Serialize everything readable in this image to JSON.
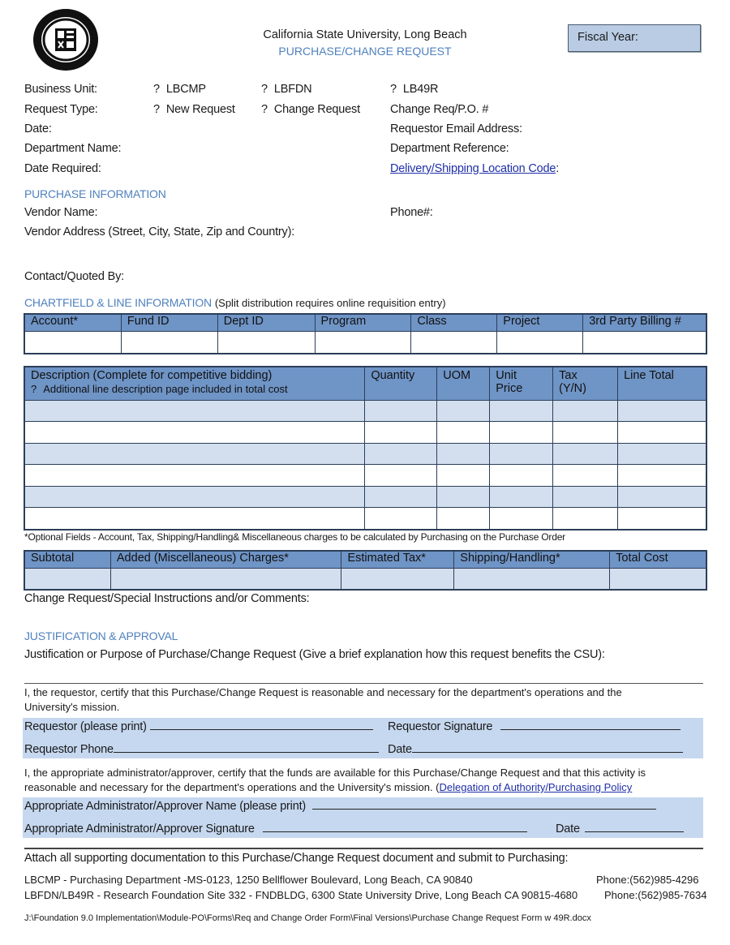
{
  "header": {
    "logo_icon": "university-seal-icon",
    "university": "California State University, Long Beach",
    "form_title": "PURCHASE/CHANGE REQUEST",
    "fiscal_year_label": "Fiscal Year:"
  },
  "general": {
    "business_unit_label": "Business Unit:",
    "business_unit_options": [
      "LBCMP",
      "LBFDN",
      "LB49R"
    ],
    "request_type_label": "Request Type:",
    "request_type_options": [
      "New Request",
      "Change Request"
    ],
    "checkbox_glyph": "?",
    "change_req_label": "Change Req/P.O. #",
    "date_label": "Date:",
    "requestor_email_label": "Requestor Email Address:",
    "department_name_label": "Department Name:",
    "department_reference_label": "Department Reference:",
    "date_required_label": "Date Required:",
    "delivery_link": "Delivery/Shipping Location Code",
    "delivery_colon": ":"
  },
  "purchase_info": {
    "section_title": "PURCHASE INFORMATION",
    "vendor_name_label": "Vendor Name:",
    "phone_label": "Phone#:",
    "vendor_address_label": "Vendor Address (Street, City, State, Zip and Country):",
    "contact_label": "Contact/Quoted By:"
  },
  "chartfield": {
    "section_title": "CHARTFIELD & LINE INFORMATION",
    "note": "(Split distribution requires online requisition entry)",
    "columns": [
      "Account*",
      "Fund ID",
      "Dept ID",
      "Program",
      "Class",
      "Project",
      "3rd Party Billing #"
    ]
  },
  "line_items": {
    "description_header": "Description (Complete for competitive bidding)",
    "additional_page_note": "Additional line description page included in total cost",
    "columns": [
      "Quantity",
      "UOM",
      "Unit Price",
      "Tax (Y/N)",
      "Line Total"
    ],
    "unit_price_line1": "Unit",
    "unit_price_line2": "Price",
    "tax_line1": "Tax",
    "tax_line2": "(Y/N)",
    "row_count": 6
  },
  "optional_note": "*Optional Fields - Account, Tax, Shipping/Handling& Miscellaneous charges to be calculated by Purchasing on the Purchase Order",
  "totals": {
    "columns": [
      "Subtotal",
      "Added (Miscellaneous) Charges*",
      "Estimated Tax*",
      "Shipping/Handling*",
      "Total Cost"
    ]
  },
  "comments_label": "Change Request/Special Instructions and/or Comments:",
  "justification": {
    "section_title": "JUSTIFICATION & APPROVAL",
    "prompt": "Justification or Purpose of Purchase/Change Request (Give a brief explanation how this request benefits the CSU):",
    "requestor_cert_line1": "I, the requestor, certify that this Purchase/Change Request is reasonable and necessary for the department's operations and the",
    "requestor_cert_line2": "University's mission.",
    "requestor_print_label": "Requestor (please print)",
    "requestor_signature_label": "Requestor Signature",
    "requestor_phone_label": "Requestor Phone",
    "date_label": "Date",
    "approver_cert_line1": "I, the appropriate administrator/approver, certify that the funds are available for this Purchase/Change Request and that this activity is",
    "approver_cert_line2": "reasonable and necessary for the department's operations and the University's mission. (",
    "policy_link": "Delegation of Authority/Purchasing Policy",
    "approver_name_label": "Appropriate Administrator/Approver Name (please print)",
    "approver_signature_label": "Appropriate Administrator/Approver Signature",
    "approver_date_label": "Date"
  },
  "footer": {
    "attach_note": "Attach all supporting documentation to this Purchase/Change Request document and submit to Purchasing:",
    "lbcmp_address": "LBCMP - Purchasing Department -MS-0123, 1250 Bellflower Boulevard, Long Beach, CA 90840",
    "lbcmp_phone": "Phone:(562)985-4296",
    "lbfdn_address": "LBFDN/LB49R - Research Foundation Site 332 - FNDBLDG, 6300 State University Drive, Long Beach CA 90815-4680",
    "lbfdn_phone": "Phone:(562)985-7634",
    "file_path": "J:\\Foundation 9.0 Implementation\\Module-PO\\Forms\\Req and Change Order Form\\Final Versions\\Purchase Change Request Form w 49R.docx"
  }
}
